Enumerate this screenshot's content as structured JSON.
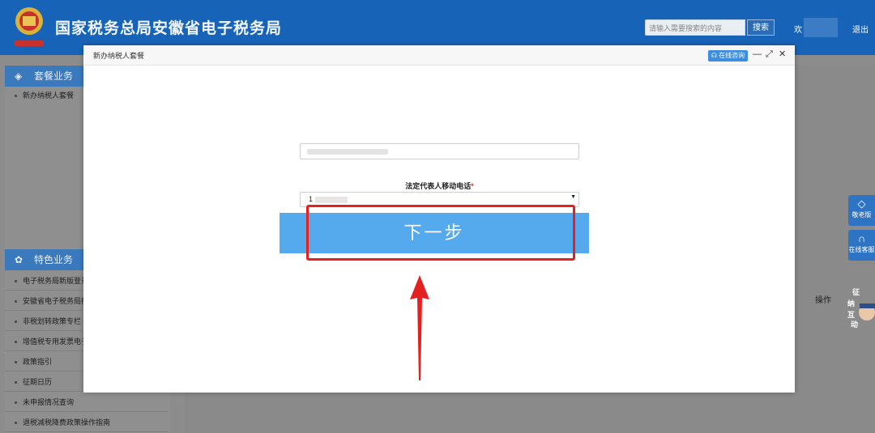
{
  "header": {
    "site_title": "国家税务总局安徽省电子税务局",
    "search_placeholder": "请输入需要搜索的内容",
    "search_button": "搜索",
    "welcome": "欢",
    "logout": "退出"
  },
  "sidebar": {
    "panels": [
      {
        "title": "套餐业务",
        "icon": "layers-icon",
        "items": [
          "新办纳税人套餐"
        ]
      },
      {
        "title": "特色业务",
        "icon": "flower-icon",
        "items": [
          "电子税务局新版登录",
          "安徽省电子税务局操",
          "非税划转政策专栏",
          "增值税专用发票电子",
          "政策指引",
          "征期日历",
          "未申报情况查询",
          "退税减税降费政策操作指南"
        ]
      }
    ]
  },
  "background": {
    "operation_header": "操作"
  },
  "float_widgets": [
    {
      "label": "敬老版",
      "icon": "tag-icon"
    },
    {
      "label": "在线客服",
      "icon": "headset-icon"
    }
  ],
  "mascot": {
    "text": "征纳互动"
  },
  "modal": {
    "title": "新办纳税人套餐",
    "consult_button": "在线咨询",
    "phone_label": "法定代表人移动电话",
    "required_mark": "*",
    "phone_prefix": "1",
    "next_button": "下一步"
  },
  "colors": {
    "header_bg": "#1763b8",
    "button_blue": "#55aaed",
    "highlight_red": "#e52020"
  }
}
